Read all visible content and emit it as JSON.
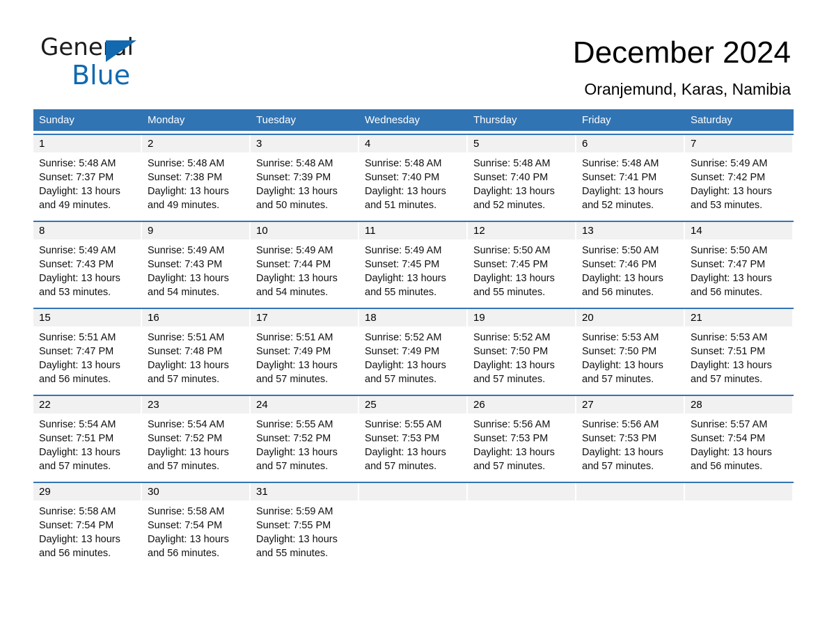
{
  "brand": {
    "name_part1": "General",
    "name_part2": "Blue",
    "triangle_color": "#1269b0",
    "text_color": "#1b1b1b"
  },
  "header": {
    "title": "December 2024",
    "location": "Oranjemund, Karas, Namibia"
  },
  "theme": {
    "header_blue": "#3174b4",
    "day_band_gray": "#f1f1f1",
    "row_divider_blue": "#3174b4"
  },
  "weekdays": [
    "Sunday",
    "Monday",
    "Tuesday",
    "Wednesday",
    "Thursday",
    "Friday",
    "Saturday"
  ],
  "weeks": [
    [
      {
        "day": "1",
        "sunrise": "Sunrise: 5:48 AM",
        "sunset": "Sunset: 7:37 PM",
        "daylight_1": "Daylight: 13 hours",
        "daylight_2": "and 49 minutes."
      },
      {
        "day": "2",
        "sunrise": "Sunrise: 5:48 AM",
        "sunset": "Sunset: 7:38 PM",
        "daylight_1": "Daylight: 13 hours",
        "daylight_2": "and 49 minutes."
      },
      {
        "day": "3",
        "sunrise": "Sunrise: 5:48 AM",
        "sunset": "Sunset: 7:39 PM",
        "daylight_1": "Daylight: 13 hours",
        "daylight_2": "and 50 minutes."
      },
      {
        "day": "4",
        "sunrise": "Sunrise: 5:48 AM",
        "sunset": "Sunset: 7:40 PM",
        "daylight_1": "Daylight: 13 hours",
        "daylight_2": "and 51 minutes."
      },
      {
        "day": "5",
        "sunrise": "Sunrise: 5:48 AM",
        "sunset": "Sunset: 7:40 PM",
        "daylight_1": "Daylight: 13 hours",
        "daylight_2": "and 52 minutes."
      },
      {
        "day": "6",
        "sunrise": "Sunrise: 5:48 AM",
        "sunset": "Sunset: 7:41 PM",
        "daylight_1": "Daylight: 13 hours",
        "daylight_2": "and 52 minutes."
      },
      {
        "day": "7",
        "sunrise": "Sunrise: 5:49 AM",
        "sunset": "Sunset: 7:42 PM",
        "daylight_1": "Daylight: 13 hours",
        "daylight_2": "and 53 minutes."
      }
    ],
    [
      {
        "day": "8",
        "sunrise": "Sunrise: 5:49 AM",
        "sunset": "Sunset: 7:43 PM",
        "daylight_1": "Daylight: 13 hours",
        "daylight_2": "and 53 minutes."
      },
      {
        "day": "9",
        "sunrise": "Sunrise: 5:49 AM",
        "sunset": "Sunset: 7:43 PM",
        "daylight_1": "Daylight: 13 hours",
        "daylight_2": "and 54 minutes."
      },
      {
        "day": "10",
        "sunrise": "Sunrise: 5:49 AM",
        "sunset": "Sunset: 7:44 PM",
        "daylight_1": "Daylight: 13 hours",
        "daylight_2": "and 54 minutes."
      },
      {
        "day": "11",
        "sunrise": "Sunrise: 5:49 AM",
        "sunset": "Sunset: 7:45 PM",
        "daylight_1": "Daylight: 13 hours",
        "daylight_2": "and 55 minutes."
      },
      {
        "day": "12",
        "sunrise": "Sunrise: 5:50 AM",
        "sunset": "Sunset: 7:45 PM",
        "daylight_1": "Daylight: 13 hours",
        "daylight_2": "and 55 minutes."
      },
      {
        "day": "13",
        "sunrise": "Sunrise: 5:50 AM",
        "sunset": "Sunset: 7:46 PM",
        "daylight_1": "Daylight: 13 hours",
        "daylight_2": "and 56 minutes."
      },
      {
        "day": "14",
        "sunrise": "Sunrise: 5:50 AM",
        "sunset": "Sunset: 7:47 PM",
        "daylight_1": "Daylight: 13 hours",
        "daylight_2": "and 56 minutes."
      }
    ],
    [
      {
        "day": "15",
        "sunrise": "Sunrise: 5:51 AM",
        "sunset": "Sunset: 7:47 PM",
        "daylight_1": "Daylight: 13 hours",
        "daylight_2": "and 56 minutes."
      },
      {
        "day": "16",
        "sunrise": "Sunrise: 5:51 AM",
        "sunset": "Sunset: 7:48 PM",
        "daylight_1": "Daylight: 13 hours",
        "daylight_2": "and 57 minutes."
      },
      {
        "day": "17",
        "sunrise": "Sunrise: 5:51 AM",
        "sunset": "Sunset: 7:49 PM",
        "daylight_1": "Daylight: 13 hours",
        "daylight_2": "and 57 minutes."
      },
      {
        "day": "18",
        "sunrise": "Sunrise: 5:52 AM",
        "sunset": "Sunset: 7:49 PM",
        "daylight_1": "Daylight: 13 hours",
        "daylight_2": "and 57 minutes."
      },
      {
        "day": "19",
        "sunrise": "Sunrise: 5:52 AM",
        "sunset": "Sunset: 7:50 PM",
        "daylight_1": "Daylight: 13 hours",
        "daylight_2": "and 57 minutes."
      },
      {
        "day": "20",
        "sunrise": "Sunrise: 5:53 AM",
        "sunset": "Sunset: 7:50 PM",
        "daylight_1": "Daylight: 13 hours",
        "daylight_2": "and 57 minutes."
      },
      {
        "day": "21",
        "sunrise": "Sunrise: 5:53 AM",
        "sunset": "Sunset: 7:51 PM",
        "daylight_1": "Daylight: 13 hours",
        "daylight_2": "and 57 minutes."
      }
    ],
    [
      {
        "day": "22",
        "sunrise": "Sunrise: 5:54 AM",
        "sunset": "Sunset: 7:51 PM",
        "daylight_1": "Daylight: 13 hours",
        "daylight_2": "and 57 minutes."
      },
      {
        "day": "23",
        "sunrise": "Sunrise: 5:54 AM",
        "sunset": "Sunset: 7:52 PM",
        "daylight_1": "Daylight: 13 hours",
        "daylight_2": "and 57 minutes."
      },
      {
        "day": "24",
        "sunrise": "Sunrise: 5:55 AM",
        "sunset": "Sunset: 7:52 PM",
        "daylight_1": "Daylight: 13 hours",
        "daylight_2": "and 57 minutes."
      },
      {
        "day": "25",
        "sunrise": "Sunrise: 5:55 AM",
        "sunset": "Sunset: 7:53 PM",
        "daylight_1": "Daylight: 13 hours",
        "daylight_2": "and 57 minutes."
      },
      {
        "day": "26",
        "sunrise": "Sunrise: 5:56 AM",
        "sunset": "Sunset: 7:53 PM",
        "daylight_1": "Daylight: 13 hours",
        "daylight_2": "and 57 minutes."
      },
      {
        "day": "27",
        "sunrise": "Sunrise: 5:56 AM",
        "sunset": "Sunset: 7:53 PM",
        "daylight_1": "Daylight: 13 hours",
        "daylight_2": "and 57 minutes."
      },
      {
        "day": "28",
        "sunrise": "Sunrise: 5:57 AM",
        "sunset": "Sunset: 7:54 PM",
        "daylight_1": "Daylight: 13 hours",
        "daylight_2": "and 56 minutes."
      }
    ],
    [
      {
        "day": "29",
        "sunrise": "Sunrise: 5:58 AM",
        "sunset": "Sunset: 7:54 PM",
        "daylight_1": "Daylight: 13 hours",
        "daylight_2": "and 56 minutes."
      },
      {
        "day": "30",
        "sunrise": "Sunrise: 5:58 AM",
        "sunset": "Sunset: 7:54 PM",
        "daylight_1": "Daylight: 13 hours",
        "daylight_2": "and 56 minutes."
      },
      {
        "day": "31",
        "sunrise": "Sunrise: 5:59 AM",
        "sunset": "Sunset: 7:55 PM",
        "daylight_1": "Daylight: 13 hours",
        "daylight_2": "and 55 minutes."
      },
      {
        "day": "",
        "sunrise": "",
        "sunset": "",
        "daylight_1": "",
        "daylight_2": ""
      },
      {
        "day": "",
        "sunrise": "",
        "sunset": "",
        "daylight_1": "",
        "daylight_2": ""
      },
      {
        "day": "",
        "sunrise": "",
        "sunset": "",
        "daylight_1": "",
        "daylight_2": ""
      },
      {
        "day": "",
        "sunrise": "",
        "sunset": "",
        "daylight_1": "",
        "daylight_2": ""
      }
    ]
  ]
}
